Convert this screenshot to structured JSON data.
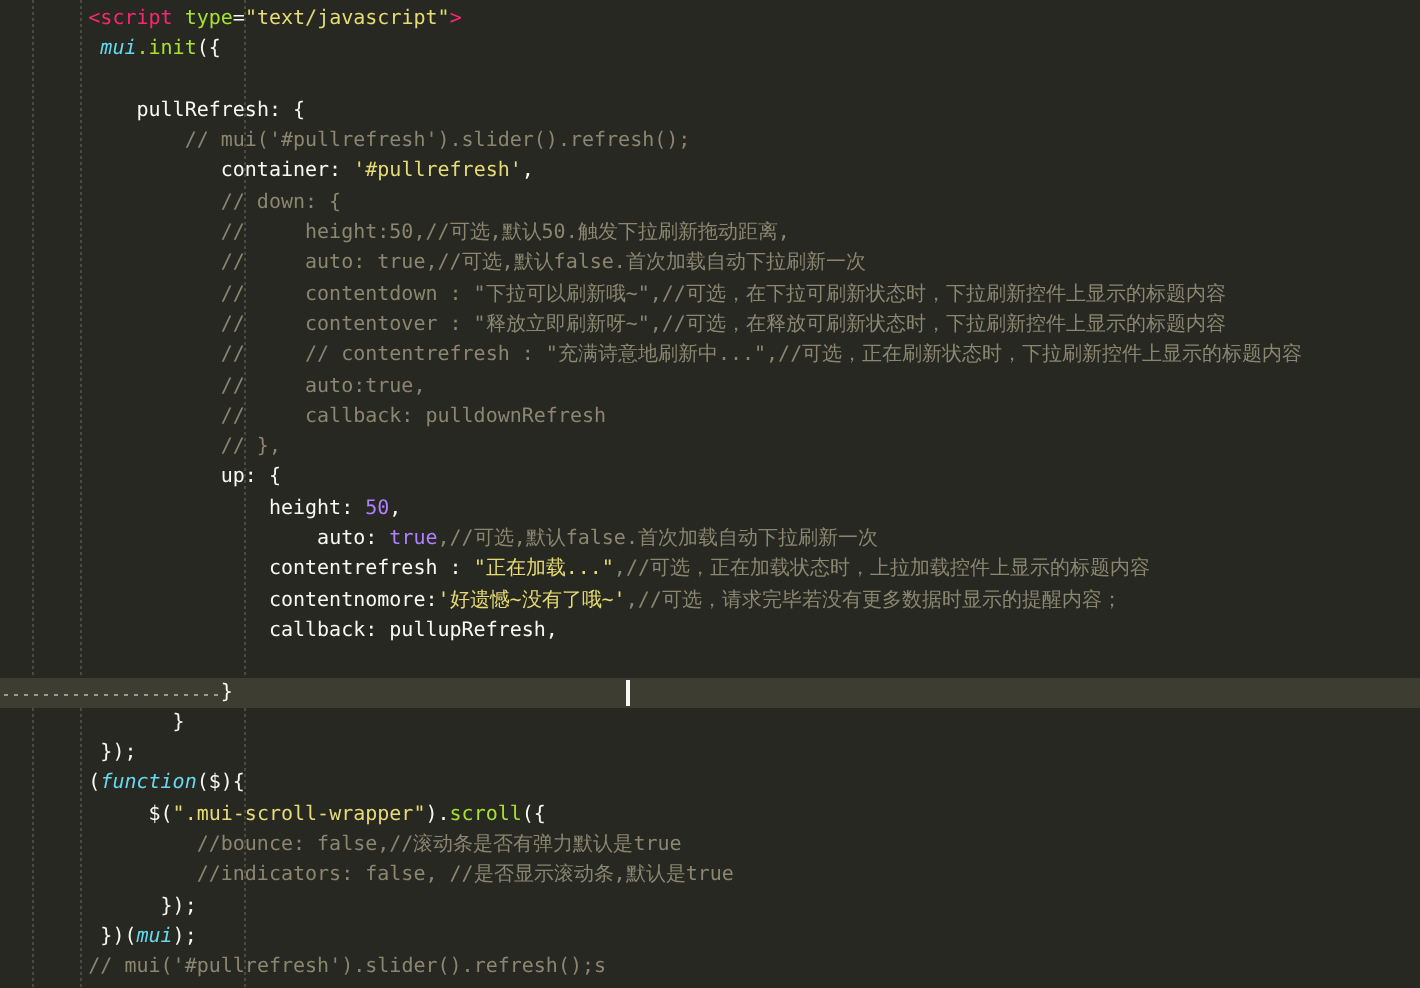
{
  "editor": {
    "lines": [
      {
        "current": false,
        "tokens": [
          {
            "kind": "tag",
            "text": "       <script "
          },
          {
            "kind": "attr",
            "text": "type"
          },
          {
            "kind": "plain",
            "text": "="
          },
          {
            "kind": "string",
            "text": "\"text/javascript\""
          },
          {
            "kind": "tag",
            "text": ">"
          }
        ]
      },
      {
        "current": false,
        "tokens": [
          {
            "kind": "var",
            "text": "        mui"
          },
          {
            "kind": "func",
            "text": ".init"
          },
          {
            "kind": "plain",
            "text": "({"
          }
        ]
      },
      {
        "current": false
      },
      {
        "current": false,
        "tokens": [
          {
            "kind": "plain",
            "text": "           pullRefresh: {"
          }
        ]
      },
      {
        "current": false,
        "tokens": [
          {
            "kind": "comment",
            "text": "               // mui('#pullrefresh').slider().refresh();"
          }
        ]
      },
      {
        "current": false,
        "tokens": [
          {
            "kind": "plain",
            "text": "                  container: "
          },
          {
            "kind": "string",
            "text": "'#pullrefresh'"
          },
          {
            "kind": "plain",
            "text": ","
          }
        ]
      },
      {
        "current": false,
        "tokens": [
          {
            "kind": "comment",
            "text": "                  // down: {"
          }
        ]
      },
      {
        "current": false,
        "tokens": [
          {
            "kind": "comment",
            "text": "                  //     height:50,//可选,默认50.触发下拉刷新拖动距离,"
          }
        ]
      },
      {
        "current": false,
        "tokens": [
          {
            "kind": "comment",
            "text": "                  //     auto: true,//可选,默认false.首次加载自动下拉刷新一次"
          }
        ]
      },
      {
        "current": false,
        "tokens": [
          {
            "kind": "comment",
            "text": "                  //     contentdown : \"下拉可以刷新哦~\",//可选，在下拉可刷新状态时，下拉刷新控件上显示的标题内容"
          }
        ]
      },
      {
        "current": false,
        "tokens": [
          {
            "kind": "comment",
            "text": "                  //     contentover : \"释放立即刷新呀~\",//可选，在释放可刷新状态时，下拉刷新控件上显示的标题内容"
          }
        ]
      },
      {
        "current": false,
        "tokens": [
          {
            "kind": "comment",
            "text": "                  //     // contentrefresh : \"充满诗意地刷新中...\",//可选，正在刷新状态时，下拉刷新控件上显示的标题内容"
          }
        ]
      },
      {
        "current": false,
        "tokens": [
          {
            "kind": "comment",
            "text": "                  //     auto:true,"
          }
        ]
      },
      {
        "current": false,
        "tokens": [
          {
            "kind": "comment",
            "text": "                  //     callback: pulldownRefresh"
          }
        ]
      },
      {
        "current": false,
        "tokens": [
          {
            "kind": "comment",
            "text": "                  // },"
          }
        ]
      },
      {
        "current": false,
        "tokens": [
          {
            "kind": "plain",
            "text": "                  up: {"
          }
        ]
      },
      {
        "current": false,
        "tokens": [
          {
            "kind": "plain",
            "text": "                      height: "
          },
          {
            "kind": "number",
            "text": "50"
          },
          {
            "kind": "plain",
            "text": ","
          }
        ]
      },
      {
        "current": false,
        "tokens": [
          {
            "kind": "plain",
            "text": "                          auto: "
          },
          {
            "kind": "number",
            "text": "true"
          },
          {
            "kind": "comment",
            "text": ",//可选,默认false.首次加载自动下拉刷新一次"
          }
        ]
      },
      {
        "current": false,
        "tokens": [
          {
            "kind": "plain",
            "text": "                      contentrefresh : "
          },
          {
            "kind": "string",
            "text": "\"正在加载...\""
          },
          {
            "kind": "comment",
            "text": ",//可选，正在加载状态时，上拉加载控件上显示的标题内容"
          }
        ]
      },
      {
        "current": false,
        "tokens": [
          {
            "kind": "plain",
            "text": "                      contentnomore:"
          },
          {
            "kind": "string",
            "text": "'好遗憾~没有了哦~'"
          },
          {
            "kind": "comment",
            "text": ",//可选，请求完毕若没有更多数据时显示的提醒内容；"
          }
        ]
      },
      {
        "current": false,
        "tokens": [
          {
            "kind": "plain",
            "text": "                      callback: pullupRefresh,"
          }
        ]
      },
      {
        "current": false
      },
      {
        "current": true,
        "tokens": [
          {
            "kind": "plain",
            "text": "                  }"
          }
        ]
      },
      {
        "current": false,
        "tokens": [
          {
            "kind": "plain",
            "text": "              }"
          }
        ]
      },
      {
        "current": false,
        "tokens": [
          {
            "kind": "plain",
            "text": "        });"
          }
        ]
      },
      {
        "current": false,
        "tokens": [
          {
            "kind": "plain",
            "text": "       ("
          },
          {
            "kind": "keyword",
            "text": "function"
          },
          {
            "kind": "plain",
            "text": "($){"
          }
        ]
      },
      {
        "current": false,
        "tokens": [
          {
            "kind": "plain",
            "text": "            $("
          },
          {
            "kind": "string",
            "text": "\".mui-scroll-wrapper\""
          },
          {
            "kind": "plain",
            "text": ")."
          },
          {
            "kind": "func",
            "text": "scroll"
          },
          {
            "kind": "plain",
            "text": "({"
          }
        ]
      },
      {
        "current": false,
        "tokens": [
          {
            "kind": "comment",
            "text": "                //bounce: false,//滚动条是否有弹力默认是true"
          }
        ]
      },
      {
        "current": false,
        "tokens": [
          {
            "kind": "comment",
            "text": "                //indicators: false, //是否显示滚动条,默认是true"
          }
        ]
      },
      {
        "current": false,
        "tokens": [
          {
            "kind": "plain",
            "text": "             });"
          }
        ]
      },
      {
        "current": false,
        "tokens": [
          {
            "kind": "plain",
            "text": "        })("
          },
          {
            "kind": "var",
            "text": "mui"
          },
          {
            "kind": "plain",
            "text": ");"
          }
        ]
      },
      {
        "current": false,
        "tokens": [
          {
            "kind": "comment",
            "text": "       // mui('#pullrefresh').slider().refresh();s"
          }
        ]
      }
    ]
  }
}
